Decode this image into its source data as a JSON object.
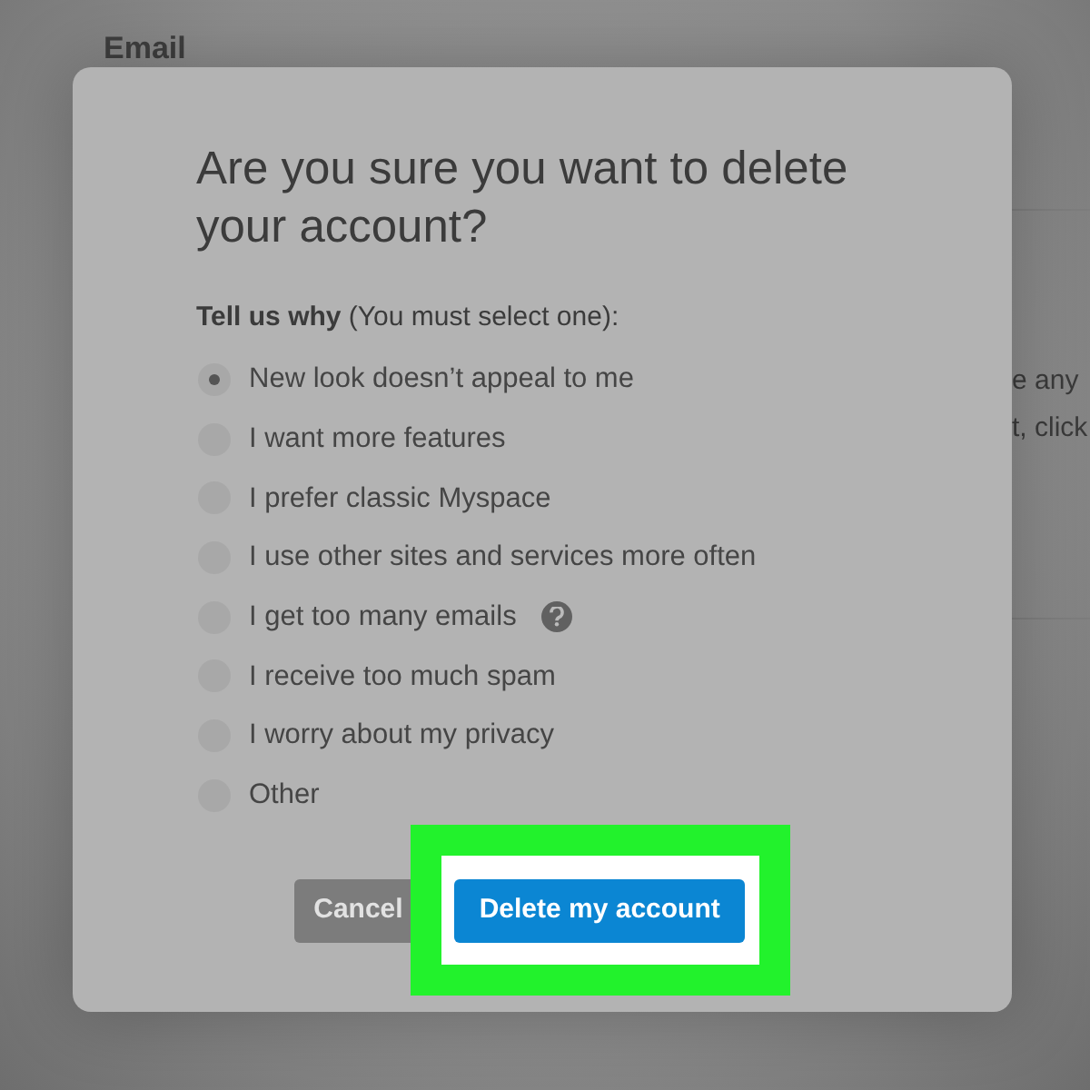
{
  "background": {
    "field_label": "Email",
    "text_fragments": [
      "e any",
      "t, click"
    ]
  },
  "dialog": {
    "title": "Are you sure you want to delete your account?",
    "prompt": "**Tell us why** (You must select one):",
    "options": [
      {
        "label": "New look doesn’t appeal to me",
        "selected": true,
        "help_icon": false
      },
      {
        "label": "I want more features",
        "selected": false,
        "help_icon": false
      },
      {
        "label": "I prefer classic Myspace",
        "selected": false,
        "help_icon": false
      },
      {
        "label": "I use other sites and services more often",
        "selected": false,
        "help_icon": false
      },
      {
        "label": "I get too many emails",
        "selected": false,
        "help_icon": true
      },
      {
        "label": "I receive too much spam",
        "selected": false,
        "help_icon": false
      },
      {
        "label": "I worry about my privacy",
        "selected": false,
        "help_icon": false
      },
      {
        "label": "Other",
        "selected": false,
        "help_icon": false
      }
    ],
    "buttons": [
      {
        "label": "Cancel",
        "kind": "secondary",
        "highlighted": false
      },
      {
        "label": "Delete my account",
        "kind": "primary",
        "highlighted": true
      }
    ]
  }
}
